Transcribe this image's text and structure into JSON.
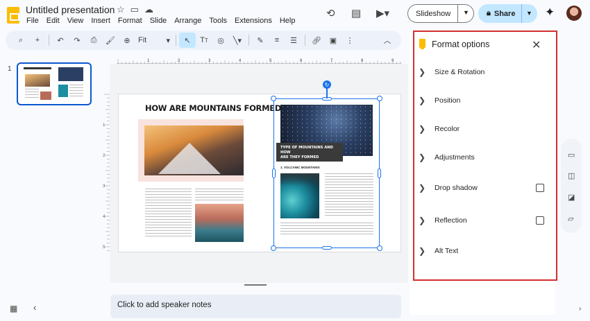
{
  "app": {
    "doc_title": "Untitled presentation",
    "menu": [
      "File",
      "Edit",
      "View",
      "Insert",
      "Format",
      "Slide",
      "Arrange",
      "Tools",
      "Extensions",
      "Help"
    ],
    "slideshow_label": "Slideshow",
    "share_label": "Share"
  },
  "toolbar": {
    "zoom_value": "Fit"
  },
  "filmstrip": {
    "slide_number": "1"
  },
  "slide": {
    "heading": "HOW ARE MOUNTAINS FORMED?",
    "banner_line1": "TYPE OF MOUNTAINS AND HOW",
    "banner_line2": "ARE THEY FORMED",
    "subheading": "1. VOLCANIC MOUNTAINS"
  },
  "notes": {
    "placeholder": "Click to add speaker notes"
  },
  "format_panel": {
    "title": "Format options",
    "sections": [
      {
        "label": "Size & Rotation",
        "checkbox": false
      },
      {
        "label": "Position",
        "checkbox": false
      },
      {
        "label": "Recolor",
        "checkbox": false
      },
      {
        "label": "Adjustments",
        "checkbox": false
      },
      {
        "label": "Drop shadow",
        "checkbox": true,
        "checked": false
      },
      {
        "label": "Reflection",
        "checkbox": true,
        "checked": false
      },
      {
        "label": "Alt Text",
        "checkbox": false
      }
    ],
    "highlight_color": "#d32f2f"
  },
  "ruler": {
    "top_ticks": [
      "1",
      "2",
      "3",
      "4",
      "5",
      "6",
      "7",
      "8",
      "9"
    ],
    "left_ticks": [
      "1",
      "2",
      "3",
      "4",
      "5"
    ]
  },
  "colors": {
    "accent": "#0b57d0",
    "share_bg": "#c2e7ff",
    "selection": "#1a73e8",
    "slides_logo": "#fbbc04"
  }
}
